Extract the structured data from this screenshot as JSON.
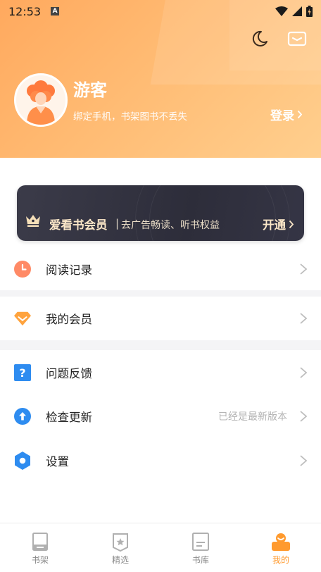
{
  "status_bar": {
    "time": "12:53",
    "notification_letter": "A"
  },
  "header": {
    "nickname": "游客",
    "bind_tip": "绑定手机，书架图书不丢失",
    "login_label": "登录"
  },
  "vip": {
    "title": "爱看书会员",
    "separator": "|",
    "description": "去广告畅读、听书权益",
    "open_label": "开通"
  },
  "menu": {
    "reading_history": "阅读记录",
    "my_membership": "我的会员",
    "feedback": "问题反馈",
    "check_update": "检查更新",
    "check_update_status": "已经是最新版本",
    "settings": "设置"
  },
  "tabs": [
    {
      "label": "书架",
      "icon": "bookshelf-icon"
    },
    {
      "label": "精选",
      "icon": "featured-icon"
    },
    {
      "label": "书库",
      "icon": "library-icon"
    },
    {
      "label": "我的",
      "icon": "profile-icon",
      "active": true
    }
  ],
  "colors": {
    "accent": "#ff9a2e",
    "header_gradient_start": "#ffa95e",
    "header_gradient_end": "#ffcf8e",
    "vip_card": "#2d2d3a",
    "vip_text": "#fbe7c8"
  }
}
